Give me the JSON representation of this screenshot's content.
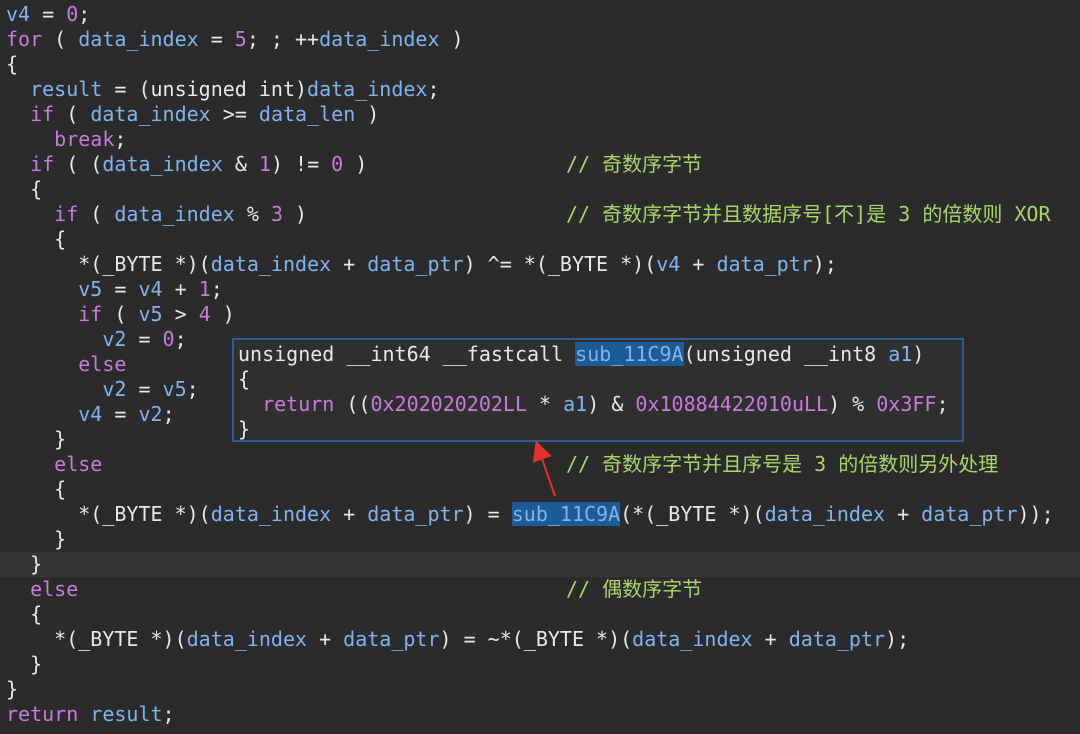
{
  "code_lines": [
    {
      "segments": [
        [
          "v4",
          "var"
        ],
        [
          " = ",
          "plain"
        ],
        [
          "0",
          "num"
        ],
        [
          ";",
          "plain"
        ]
      ]
    },
    {
      "segments": [
        [
          "for",
          "kw"
        ],
        [
          " ( ",
          "plain"
        ],
        [
          "data_index",
          "var"
        ],
        [
          " = ",
          "plain"
        ],
        [
          "5",
          "num"
        ],
        [
          "; ; ++",
          "plain"
        ],
        [
          "data_index",
          "var"
        ],
        [
          " )",
          "plain"
        ]
      ]
    },
    {
      "segments": [
        [
          "{",
          "plain"
        ]
      ]
    },
    {
      "segments": [
        [
          "  ",
          "plain"
        ],
        [
          "result",
          "var"
        ],
        [
          " = (unsigned int)",
          "plain"
        ],
        [
          "data_index",
          "var"
        ],
        [
          ";",
          "plain"
        ]
      ]
    },
    {
      "segments": [
        [
          "  ",
          "plain"
        ],
        [
          "if",
          "kw"
        ],
        [
          " ( ",
          "plain"
        ],
        [
          "data_index",
          "var"
        ],
        [
          " >= ",
          "plain"
        ],
        [
          "data_len",
          "var"
        ],
        [
          " )",
          "plain"
        ]
      ]
    },
    {
      "segments": [
        [
          "    ",
          "plain"
        ],
        [
          "break",
          "kw"
        ],
        [
          ";",
          "plain"
        ]
      ]
    },
    {
      "segments": [
        [
          "  ",
          "plain"
        ],
        [
          "if",
          "kw"
        ],
        [
          " ( (",
          "plain"
        ],
        [
          "data_index",
          "var"
        ],
        [
          " & ",
          "plain"
        ],
        [
          "1",
          "num"
        ],
        [
          ") != ",
          "plain"
        ],
        [
          "0",
          "num"
        ],
        [
          " )",
          "plain"
        ]
      ],
      "comment": "// 奇数序字节"
    },
    {
      "segments": [
        [
          "  {",
          "plain"
        ]
      ]
    },
    {
      "segments": [
        [
          "    ",
          "plain"
        ],
        [
          "if",
          "kw"
        ],
        [
          " ( ",
          "plain"
        ],
        [
          "data_index",
          "var"
        ],
        [
          " % ",
          "plain"
        ],
        [
          "3",
          "num"
        ],
        [
          " )",
          "plain"
        ]
      ],
      "comment": "// 奇数序字节并且数据序号[不]是 3 的倍数则 XOR"
    },
    {
      "segments": [
        [
          "    {",
          "plain"
        ]
      ]
    },
    {
      "segments": [
        [
          "      *(_BYTE *)(",
          "plain"
        ],
        [
          "data_index",
          "var"
        ],
        [
          " + ",
          "plain"
        ],
        [
          "data_ptr",
          "var"
        ],
        [
          ") ^= *(_BYTE *)(",
          "plain"
        ],
        [
          "v4",
          "var"
        ],
        [
          " + ",
          "plain"
        ],
        [
          "data_ptr",
          "var"
        ],
        [
          ");",
          "plain"
        ]
      ]
    },
    {
      "segments": [
        [
          "      ",
          "plain"
        ],
        [
          "v5",
          "var"
        ],
        [
          " = ",
          "plain"
        ],
        [
          "v4",
          "var"
        ],
        [
          " + ",
          "plain"
        ],
        [
          "1",
          "num"
        ],
        [
          ";",
          "plain"
        ]
      ]
    },
    {
      "segments": [
        [
          "      ",
          "plain"
        ],
        [
          "if",
          "kw"
        ],
        [
          " ( ",
          "plain"
        ],
        [
          "v5",
          "var"
        ],
        [
          " > ",
          "plain"
        ],
        [
          "4",
          "num"
        ],
        [
          " )",
          "plain"
        ]
      ]
    },
    {
      "segments": [
        [
          "        ",
          "plain"
        ],
        [
          "v2",
          "var"
        ],
        [
          " = ",
          "plain"
        ],
        [
          "0",
          "num"
        ],
        [
          ";",
          "plain"
        ]
      ]
    },
    {
      "segments": [
        [
          "      ",
          "plain"
        ],
        [
          "else",
          "kw"
        ]
      ]
    },
    {
      "segments": [
        [
          "        ",
          "plain"
        ],
        [
          "v2",
          "var"
        ],
        [
          " = ",
          "plain"
        ],
        [
          "v5",
          "var"
        ],
        [
          ";",
          "plain"
        ]
      ]
    },
    {
      "segments": [
        [
          "      ",
          "plain"
        ],
        [
          "v4",
          "var"
        ],
        [
          " = ",
          "plain"
        ],
        [
          "v2",
          "var"
        ],
        [
          ";",
          "plain"
        ]
      ]
    },
    {
      "segments": [
        [
          "    }",
          "plain"
        ]
      ]
    },
    {
      "segments": [
        [
          "    ",
          "plain"
        ],
        [
          "else",
          "kw"
        ]
      ],
      "comment": "// 奇数序字节并且序号是 3 的倍数则另外处理"
    },
    {
      "segments": [
        [
          "    {",
          "plain"
        ]
      ]
    },
    {
      "segments": [
        [
          "      *(_BYTE *)(",
          "plain"
        ],
        [
          "data_index",
          "var"
        ],
        [
          " + ",
          "plain"
        ],
        [
          "data_ptr",
          "var"
        ],
        [
          ") = ",
          "plain"
        ],
        [
          "sub_11C9A",
          "sel"
        ],
        [
          "(*(_BYTE *)(",
          "plain"
        ],
        [
          "data_index",
          "var"
        ],
        [
          " + ",
          "plain"
        ],
        [
          "data_ptr",
          "var"
        ],
        [
          "));",
          "plain"
        ]
      ]
    },
    {
      "segments": [
        [
          "    }",
          "plain"
        ]
      ]
    },
    {
      "segments": [
        [
          "  }",
          "plain"
        ]
      ],
      "highlight": true
    },
    {
      "segments": [
        [
          "  ",
          "plain"
        ],
        [
          "else",
          "kw"
        ]
      ],
      "comment": "// 偶数序字节"
    },
    {
      "segments": [
        [
          "  {",
          "plain"
        ]
      ]
    },
    {
      "segments": [
        [
          "    *(_BYTE *)(",
          "plain"
        ],
        [
          "data_index",
          "var"
        ],
        [
          " + ",
          "plain"
        ],
        [
          "data_ptr",
          "var"
        ],
        [
          ") = ~*(_BYTE *)(",
          "plain"
        ],
        [
          "data_index",
          "var"
        ],
        [
          " + ",
          "plain"
        ],
        [
          "data_ptr",
          "var"
        ],
        [
          ");",
          "plain"
        ]
      ]
    },
    {
      "segments": [
        [
          "  }",
          "plain"
        ]
      ]
    },
    {
      "segments": [
        [
          "}",
          "plain"
        ]
      ]
    },
    {
      "segments": [
        [
          "return",
          "kw"
        ],
        [
          " ",
          "plain"
        ],
        [
          "result",
          "var"
        ],
        [
          ";",
          "plain"
        ]
      ]
    }
  ],
  "tooltip": {
    "lines": [
      {
        "segments": [
          [
            "unsigned __int64 __fastcall ",
            "plain"
          ],
          [
            "sub_11C9A",
            "sel"
          ],
          [
            "(unsigned __int8 ",
            "plain"
          ],
          [
            "a1",
            "var"
          ],
          [
            ")",
            "plain"
          ]
        ]
      },
      {
        "segments": [
          [
            "{",
            "plain"
          ]
        ]
      },
      {
        "segments": [
          [
            "  ",
            "plain"
          ],
          [
            "return",
            "kw"
          ],
          [
            " ((",
            "plain"
          ],
          [
            "0x202020202LL",
            "num"
          ],
          [
            " * ",
            "plain"
          ],
          [
            "a1",
            "var"
          ],
          [
            ") & ",
            "plain"
          ],
          [
            "0x10884422010uLL",
            "num"
          ],
          [
            ") % ",
            "plain"
          ],
          [
            "0x3FF",
            "num"
          ],
          [
            ";",
            "plain"
          ]
        ]
      },
      {
        "segments": [
          [
            "}",
            "plain"
          ]
        ]
      }
    ]
  },
  "colors": {
    "background": "#2b2b2b",
    "keyword": "#c97bdb",
    "identifier": "#7fb4f0",
    "plain": "#e8e8e8",
    "number": "#c97bdb",
    "comment": "#a8d66a",
    "selection_bg": "#1c5b95",
    "tooltip_border": "#2c5e94",
    "arrow": "#e03030"
  }
}
